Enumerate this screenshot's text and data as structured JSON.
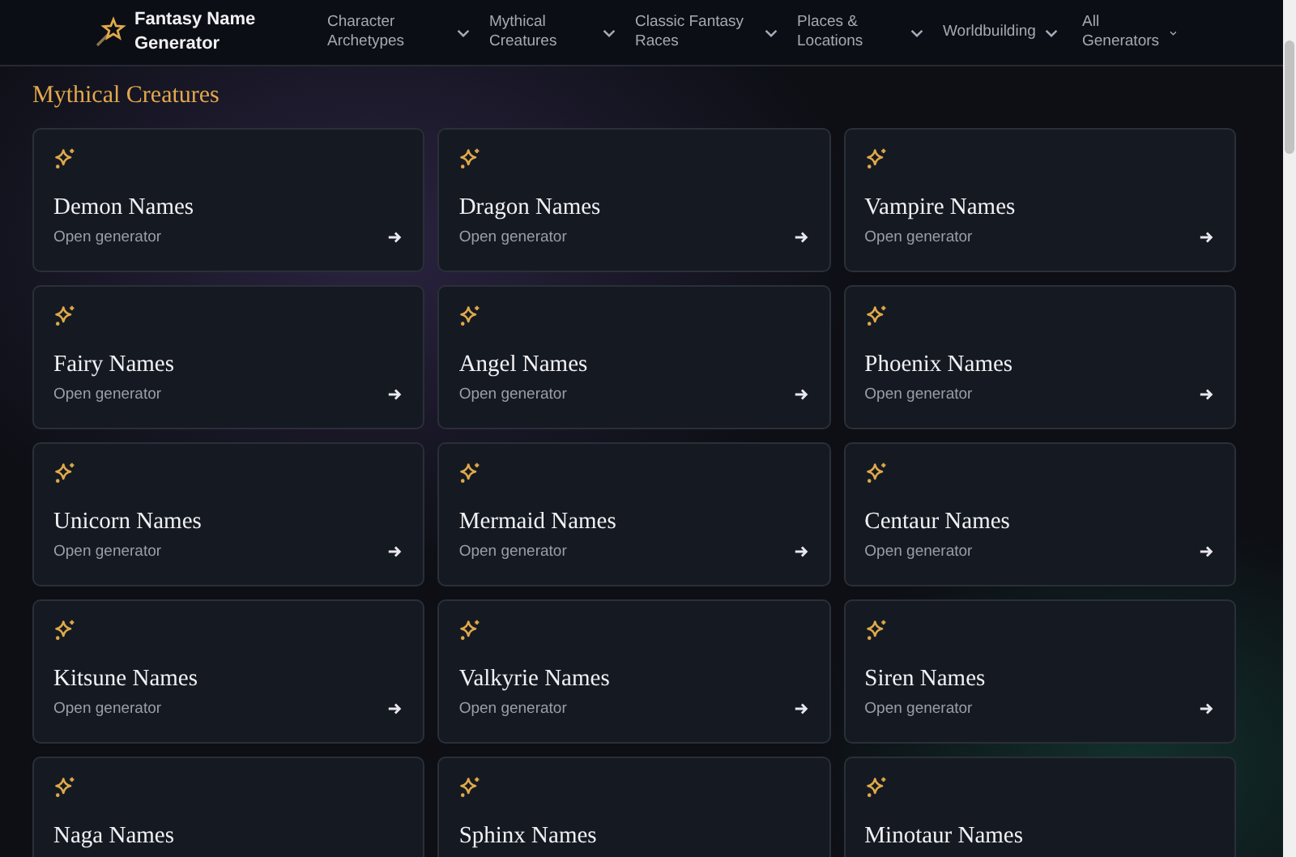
{
  "header": {
    "logo": "Fantasy Name Generator",
    "nav": [
      {
        "label": "Character Archetypes"
      },
      {
        "label": "Mythical Creatures"
      },
      {
        "label": "Classic Fantasy Races"
      },
      {
        "label": "Places & Locations"
      },
      {
        "label": "Worldbuilding"
      },
      {
        "label": "All Generators"
      }
    ]
  },
  "section": {
    "title": "Mythical Creatures",
    "cards": [
      {
        "title": "Demon Names",
        "subtitle": "Open generator"
      },
      {
        "title": "Dragon Names",
        "subtitle": "Open generator"
      },
      {
        "title": "Vampire Names",
        "subtitle": "Open generator"
      },
      {
        "title": "Fairy Names",
        "subtitle": "Open generator"
      },
      {
        "title": "Angel Names",
        "subtitle": "Open generator"
      },
      {
        "title": "Phoenix Names",
        "subtitle": "Open generator"
      },
      {
        "title": "Unicorn Names",
        "subtitle": "Open generator"
      },
      {
        "title": "Mermaid Names",
        "subtitle": "Open generator"
      },
      {
        "title": "Centaur Names",
        "subtitle": "Open generator"
      },
      {
        "title": "Kitsune Names",
        "subtitle": "Open generator"
      },
      {
        "title": "Valkyrie Names",
        "subtitle": "Open generator"
      },
      {
        "title": "Siren Names",
        "subtitle": "Open generator"
      },
      {
        "title": "Naga Names"
      },
      {
        "title": "Sphinx Names"
      },
      {
        "title": "Minotaur Names"
      }
    ]
  }
}
